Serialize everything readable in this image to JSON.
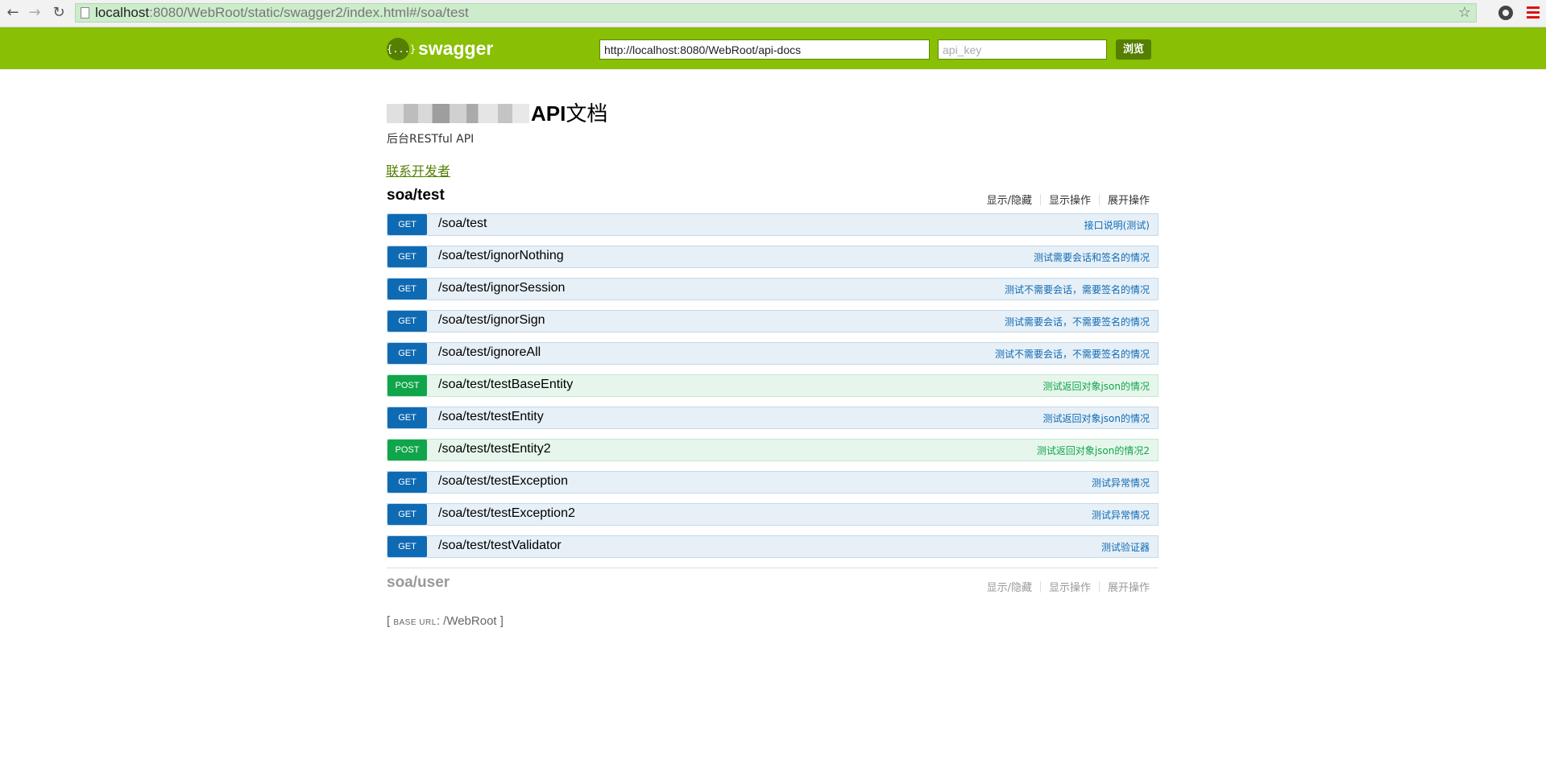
{
  "browser": {
    "url_host": "localhost",
    "url_rest": ":8080/WebRoot/static/swagger2/index.html#/soa/test",
    "back_icon": "arrow-left-icon",
    "forward_icon": "arrow-right-icon",
    "reload_icon": "reload-icon",
    "star_icon": "star-icon",
    "back_glyph": "←",
    "forward_glyph": "→",
    "reload_glyph": "↻",
    "star_glyph": "☆"
  },
  "header": {
    "logo_glyph": "{...}",
    "logo_text": "swagger",
    "api_url": "http://localhost:8080/WebRoot/api-docs",
    "api_key_placeholder": "api_key",
    "explore_label": "浏览",
    "bar_color": "#89bf04"
  },
  "info": {
    "title_suffix": "API",
    "title_cn": "文档",
    "description": "后台RESTful API",
    "contact_label": "联系开发者"
  },
  "resources": [
    {
      "name": "soa/test",
      "actions": [
        "显示/隐藏",
        "显示操作",
        "展开操作"
      ],
      "operations": [
        {
          "method": "GET",
          "path": "/soa/test",
          "summary": "接口说明(测试)"
        },
        {
          "method": "GET",
          "path": "/soa/test/ignorNothing",
          "summary": "测试需要会话和签名的情况"
        },
        {
          "method": "GET",
          "path": "/soa/test/ignorSession",
          "summary": "测试不需要会话，需要签名的情况"
        },
        {
          "method": "GET",
          "path": "/soa/test/ignorSign",
          "summary": "测试需要会话，不需要签名的情况"
        },
        {
          "method": "GET",
          "path": "/soa/test/ignoreAll",
          "summary": "测试不需要会话，不需要签名的情况"
        },
        {
          "method": "POST",
          "path": "/soa/test/testBaseEntity",
          "summary": "测试返回对象json的情况"
        },
        {
          "method": "GET",
          "path": "/soa/test/testEntity",
          "summary": "测试返回对象json的情况"
        },
        {
          "method": "POST",
          "path": "/soa/test/testEntity2",
          "summary": "测试返回对象json的情况2"
        },
        {
          "method": "GET",
          "path": "/soa/test/testException",
          "summary": "测试异常情况"
        },
        {
          "method": "GET",
          "path": "/soa/test/testException2",
          "summary": "测试异常情况"
        },
        {
          "method": "GET",
          "path": "/soa/test/testValidator",
          "summary": "测试验证器"
        }
      ]
    },
    {
      "name": "soa/user",
      "actions": [
        "显示/隐藏",
        "显示操作",
        "展开操作"
      ],
      "operations": []
    }
  ],
  "footer": {
    "base_url_label": "BASE URL",
    "base_url_open": "[ ",
    "base_url_colon": ": ",
    "base_url_value": "/WebRoot",
    "base_url_close": " ]"
  },
  "colors": {
    "get": "#0f6ab4",
    "post": "#10a54a"
  }
}
